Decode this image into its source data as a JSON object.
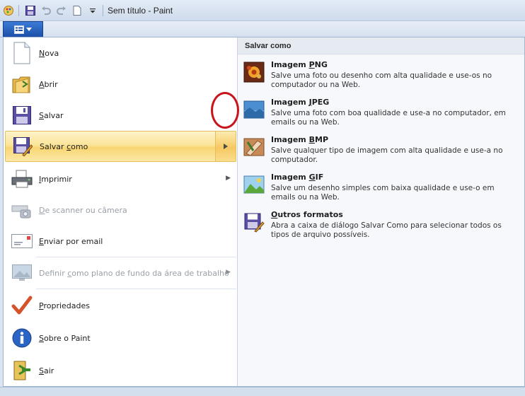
{
  "window": {
    "title": "Sem título - Paint"
  },
  "menu": {
    "items": [
      {
        "label": "Nova",
        "mnemonic": "N",
        "rest": "ova",
        "icon": "new-document-icon",
        "enabled": true
      },
      {
        "label": "Abrir",
        "mnemonic": "A",
        "rest": "brir",
        "icon": "open-folder-icon",
        "enabled": true
      },
      {
        "label": "Salvar",
        "mnemonic": "S",
        "rest": "alvar",
        "icon": "save-floppy-icon",
        "enabled": true
      },
      {
        "label": "Salvar como",
        "pre": "Salvar ",
        "mnemonic": "c",
        "rest": "omo",
        "icon": "save-as-icon",
        "enabled": true,
        "selected": true,
        "submenu": true
      },
      {
        "label": "Imprimir",
        "mnemonic": "I",
        "rest": "mprimir",
        "icon": "printer-icon",
        "enabled": true,
        "submenu": true
      },
      {
        "label": "De scanner ou câmera",
        "mnemonic": "D",
        "rest": "e scanner ou câmera",
        "icon": "scanner-camera-icon",
        "enabled": false
      },
      {
        "label": "Enviar por email",
        "mnemonic": "E",
        "rest": "nviar por email",
        "icon": "email-icon",
        "enabled": true
      },
      {
        "label": "Definir como plano de fundo da área de trabalho",
        "pre": "Definir ",
        "mnemonic": "c",
        "rest": "omo plano de fundo da área de trabalho",
        "icon": "desktop-background-icon",
        "enabled": false,
        "submenu": true
      },
      {
        "label": "Propriedades",
        "mnemonic": "P",
        "rest": "ropriedades",
        "icon": "checkmark-icon",
        "enabled": true
      },
      {
        "label": "Sobre o Paint",
        "pre": "",
        "mnemonic": "S",
        "rest": "obre o Paint",
        "mnemonic_alt": "b",
        "icon": "info-icon",
        "enabled": true
      },
      {
        "label": "Sair",
        "mnemonic": "S",
        "rest": "air",
        "icon": "exit-icon",
        "enabled": true
      }
    ]
  },
  "save_as_panel": {
    "header": "Salvar como",
    "options": [
      {
        "pre": "Imagem ",
        "mnemonic": "P",
        "rest": "NG",
        "description": "Salve uma foto ou desenho com alta qualidade e use-os no computador ou na Web.",
        "icon": "png-image-icon"
      },
      {
        "pre": "Imagem ",
        "mnemonic": "J",
        "rest": "PEG",
        "description": "Salve uma foto com boa qualidade e use-a no computador, em emails ou na Web.",
        "icon": "jpeg-image-icon"
      },
      {
        "pre": "Imagem ",
        "mnemonic": "B",
        "rest": "MP",
        "description": "Salve qualquer tipo de imagem com alta qualidade e use-a no computador.",
        "icon": "bmp-image-icon"
      },
      {
        "pre": "Imagem ",
        "mnemonic": "G",
        "rest": "IF",
        "description": "Salve um desenho simples com baixa qualidade e use-o em emails ou na Web.",
        "icon": "gif-image-icon"
      },
      {
        "pre": "",
        "mnemonic": "O",
        "rest": "utros formatos",
        "description": "Abra a caixa de diálogo Salvar Como para selecionar todos os tipos de arquivo possíveis.",
        "icon": "other-formats-icon"
      }
    ]
  },
  "colors": {
    "selection": "#fbe49a",
    "annotation_ring": "#c8141c",
    "app_button": "#1d4fa8"
  }
}
